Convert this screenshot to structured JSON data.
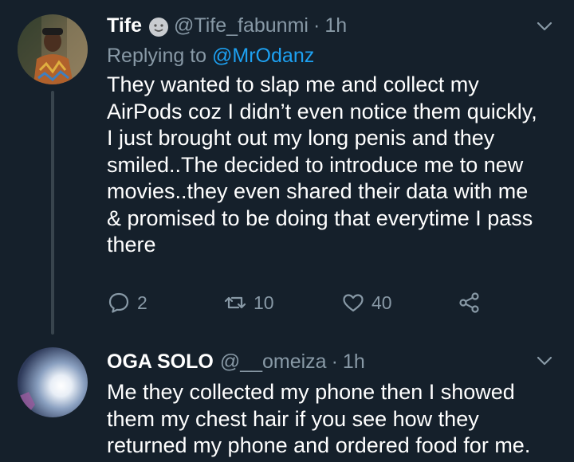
{
  "tweets": [
    {
      "display_name": "Tife",
      "handle": "@Tife_fabunmi",
      "separator": "·",
      "time": "1h",
      "replying_prefix": "Replying to",
      "replying_handle": "@MrOdanz",
      "text_lines": [
        "They wanted to slap me and collect my",
        "AirPods coz I didn’t even notice them quickly,",
        "I just brought out my long penis and they",
        "smiled..The decided to introduce me to new",
        "movies..they even shared their data with me",
        "& promised to be doing that everytime I pass",
        "there"
      ],
      "reply_count": "2",
      "retweet_count": "10",
      "like_count": "40",
      "icons": [
        "smiley-emoji-icon",
        "chevron-down-icon",
        "reply-icon",
        "retweet-icon",
        "heart-icon",
        "share-icon"
      ]
    },
    {
      "display_name": "OGA SOLO",
      "handle": "@__omeiza",
      "separator": "·",
      "time": "1h",
      "text_lines": [
        "Me they collected my phone then I showed",
        "them my chest hair if you see how they",
        "returned my phone and ordered food for me."
      ],
      "icons": [
        "chevron-down-icon"
      ]
    }
  ],
  "colors": {
    "background": "#15202b",
    "text": "#ffffff",
    "secondary": "#8899a6",
    "link": "#1da1f2",
    "thread_line": "#38444d"
  }
}
